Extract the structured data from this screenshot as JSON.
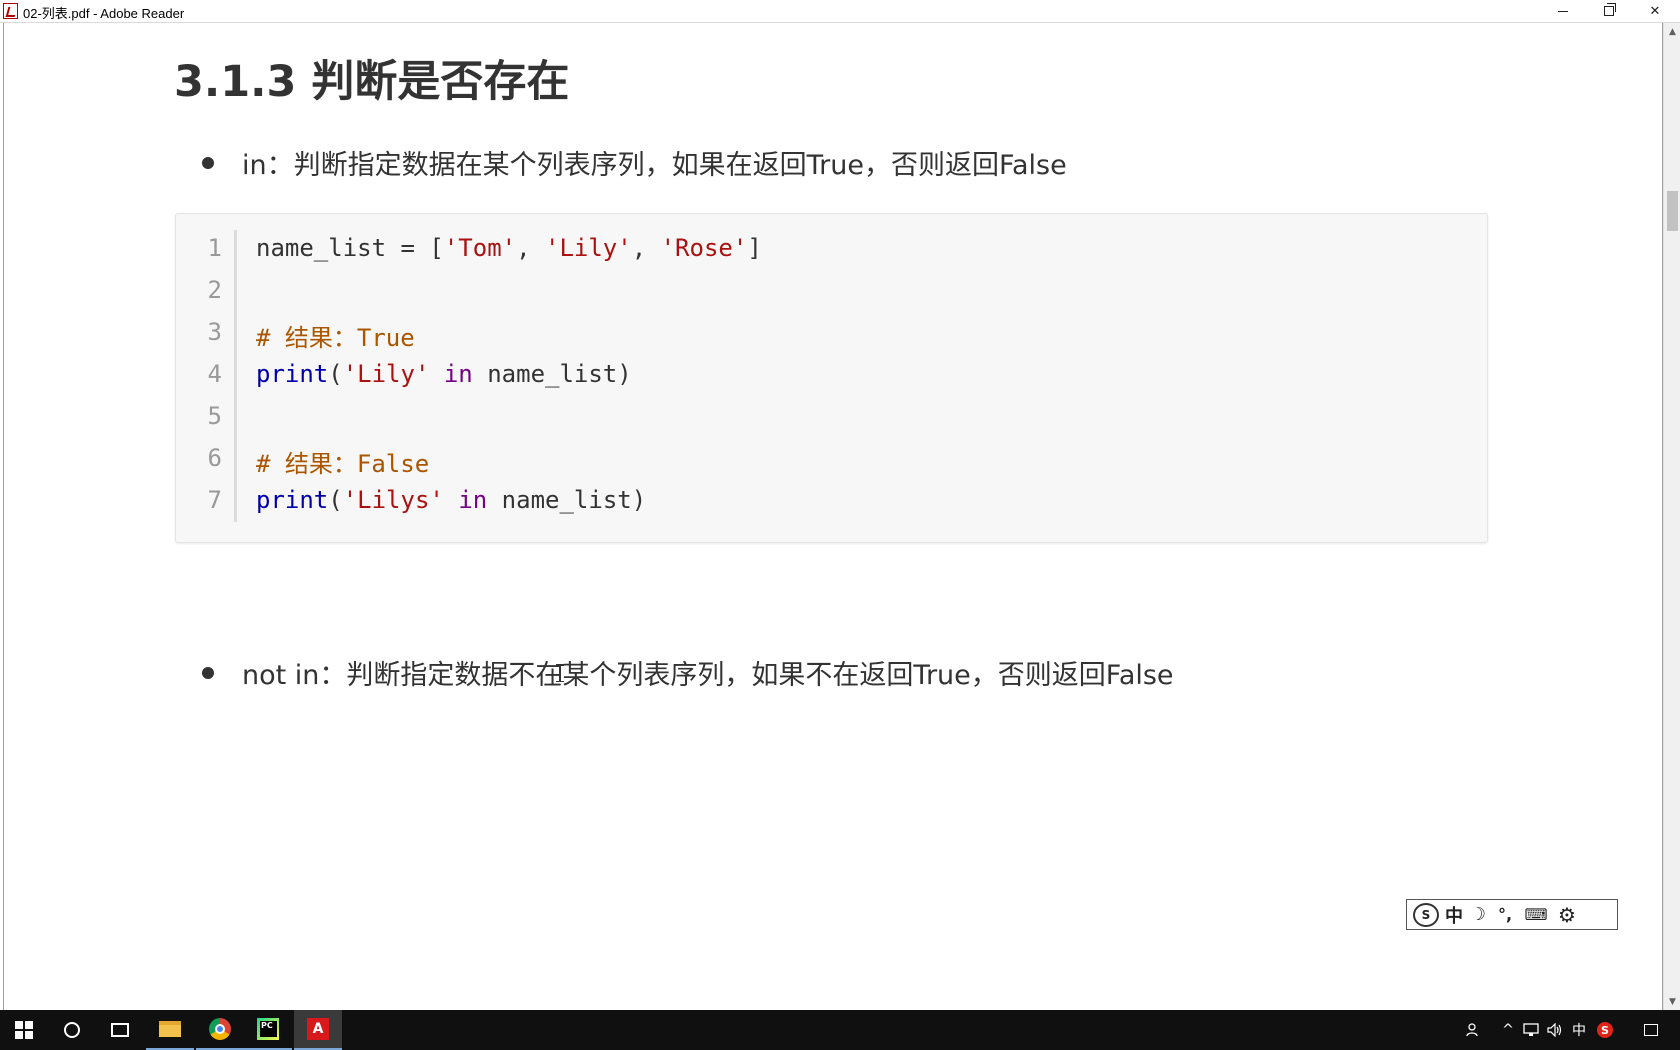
{
  "window": {
    "title": "02-列表.pdf - Adobe Reader",
    "controls": {
      "minimize": "minimize",
      "restore": "restore",
      "close": "✕"
    }
  },
  "document": {
    "heading": "3.1.3 判断是否存在",
    "bullets": [
      "in：判断指定数据在某个列表序列，如果在返回True，否则返回False",
      "not in：判断指定数据不在某个列表序列，如果不在返回True，否则返回False"
    ],
    "code": {
      "language": "python",
      "lines": [
        {
          "number": "1",
          "tokens": [
            {
              "t": "name_list = [",
              "c": "var"
            },
            {
              "t": "'Tom'",
              "c": "str"
            },
            {
              "t": ", ",
              "c": "var"
            },
            {
              "t": "'Lily'",
              "c": "str"
            },
            {
              "t": ", ",
              "c": "var"
            },
            {
              "t": "'Rose'",
              "c": "str"
            },
            {
              "t": "]",
              "c": "var"
            }
          ]
        },
        {
          "number": "2",
          "tokens": []
        },
        {
          "number": "3",
          "tokens": [
            {
              "t": "# 结果：True",
              "c": "cm"
            }
          ]
        },
        {
          "number": "4",
          "tokens": [
            {
              "t": "print",
              "c": "fn"
            },
            {
              "t": "(",
              "c": "var"
            },
            {
              "t": "'Lily'",
              "c": "str"
            },
            {
              "t": " ",
              "c": "var"
            },
            {
              "t": "in",
              "c": "kw"
            },
            {
              "t": " name_list)",
              "c": "var"
            }
          ]
        },
        {
          "number": "5",
          "tokens": []
        },
        {
          "number": "6",
          "tokens": [
            {
              "t": "# 结果：False",
              "c": "cm"
            }
          ]
        },
        {
          "number": "7",
          "tokens": [
            {
              "t": "print",
              "c": "fn"
            },
            {
              "t": "(",
              "c": "var"
            },
            {
              "t": "'Lilys'",
              "c": "str"
            },
            {
              "t": " ",
              "c": "var"
            },
            {
              "t": "in",
              "c": "kw"
            },
            {
              "t": " name_list)",
              "c": "var"
            }
          ]
        }
      ]
    }
  },
  "ime_toolbar": {
    "logo": "S",
    "mode": "中",
    "halfwidth": "☽",
    "punctuation": "°,",
    "keyboard": "⌨",
    "settings": "⚙"
  },
  "taskbar": {
    "apps": [
      "start",
      "search",
      "task-view",
      "file-explorer",
      "chrome",
      "pycharm",
      "adobe-reader"
    ],
    "pycharm_label": "PC",
    "acrobat_label": "A",
    "tray": {
      "chevron": "^",
      "lang": "中",
      "sogou": "S"
    }
  },
  "colors": {
    "string": "#aa1111",
    "keyword": "#770088",
    "builtin": "#0000aa",
    "comment": "#aa5500",
    "text": "#333333",
    "code_bg": "#f7f7f7",
    "taskbar_bg": "#101010"
  }
}
